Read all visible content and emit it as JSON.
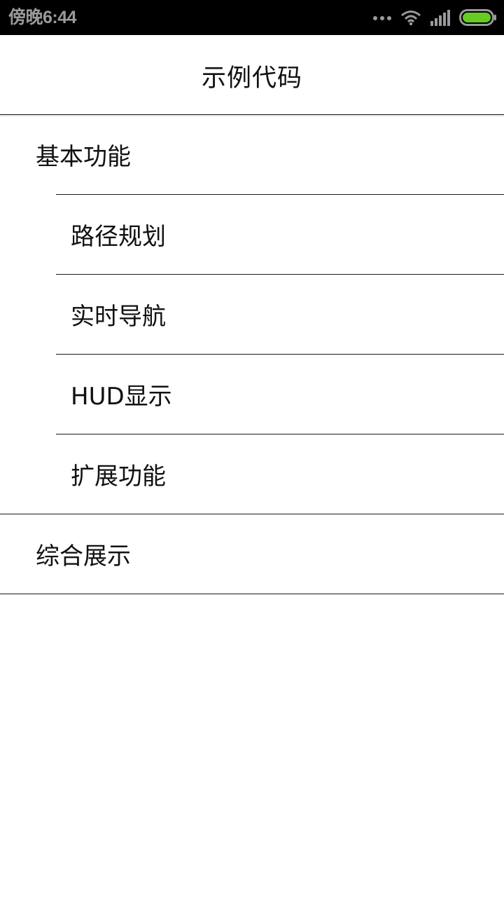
{
  "status_bar": {
    "time": "傍晚6:44",
    "icons": [
      "more-dots-icon",
      "wifi-icon",
      "signal-icon",
      "battery-icon"
    ],
    "battery_color": "#66cc22"
  },
  "header": {
    "title": "示例代码"
  },
  "list": {
    "groups": [
      {
        "label": "基本功能",
        "children": [
          {
            "label": "路径规划"
          },
          {
            "label": "实时导航"
          },
          {
            "label": "HUD显示"
          },
          {
            "label": "扩展功能"
          }
        ]
      },
      {
        "label": "综合展示",
        "children": []
      }
    ]
  }
}
